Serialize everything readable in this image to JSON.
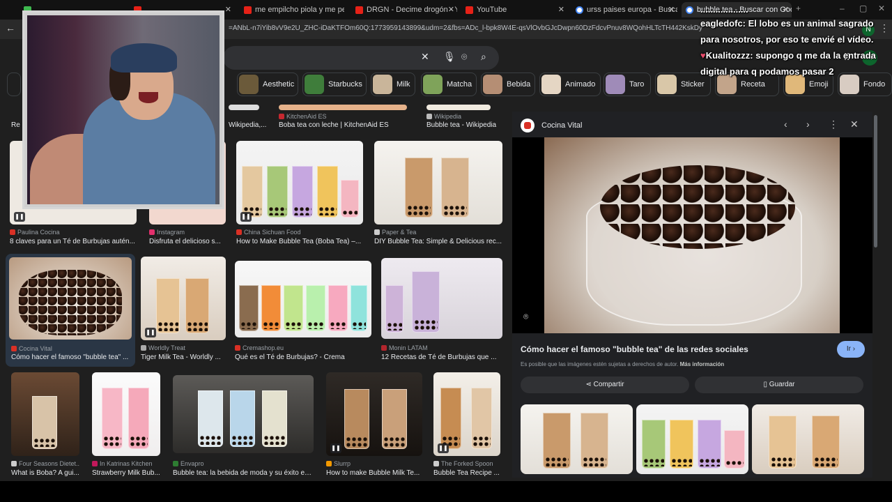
{
  "tabs": [
    {
      "title": "",
      "icon": "green-tab-icon"
    },
    {
      "title": "",
      "icon": "youtube-icon"
    },
    {
      "title": "me empilcho piola y me perfu",
      "icon": "youtube-icon"
    },
    {
      "title": "DRGN - Decime drogón - YouT",
      "icon": "youtube-icon"
    },
    {
      "title": "YouTube",
      "icon": "youtube-icon"
    },
    {
      "title": "urss paises europa - Buscar con",
      "icon": "google-icon"
    },
    {
      "title": "bubble tea - Buscar con Google",
      "icon": "google-icon",
      "active": true
    }
  ],
  "url": "=ANbL-n7iYib8vV9e2U_ZHC-iDaKTFOm60Q:1773959143899&udm=2&fbs=ADc_l-bpk8W4E-qsVlOvbGJcDwpn60DzFdcvPnuv8WQohHLTcTH442KskDyC74HpRHr",
  "profile_initial": "N",
  "chips": [
    {
      "label": "Aesthetic",
      "color": "#6b5a3a"
    },
    {
      "label": "Starbucks",
      "color": "#3f7d3b"
    },
    {
      "label": "Milk",
      "color": "#c9b59a"
    },
    {
      "label": "Matcha",
      "color": "#7fa35a"
    },
    {
      "label": "Bebida",
      "color": "#b58e74"
    },
    {
      "label": "Animado",
      "color": "#e5d6c4"
    },
    {
      "label": "Taro",
      "color": "#9f8bb8"
    },
    {
      "label": "Sticker",
      "color": "#d9c7a8"
    },
    {
      "label": "Receta",
      "color": "#c2a48a"
    },
    {
      "label": "Emoji",
      "color": "#e0b87a"
    },
    {
      "label": "Fondo",
      "color": "#d8ccc2"
    }
  ],
  "top_row": [
    {
      "source": "",
      "title": "Re"
    },
    {
      "source": "",
      "title": "Wikipedia,..."
    },
    {
      "source": "KitchenAid ES",
      "title": "Boba tea con leche | KitchenAid ES"
    },
    {
      "source": "Wikipedia",
      "title": "Bubble tea - Wikipedia"
    }
  ],
  "row1": [
    {
      "source": "Paulina Cocina",
      "title": "8 claves para un Té de Burbujas autén..."
    },
    {
      "source": "Instagram",
      "title": "Disfruta el delicioso s..."
    },
    {
      "source": "China Sichuan Food",
      "title": "How to Make Bubble Tea (Boba Tea) –..."
    },
    {
      "source": "Paper & Tea",
      "title": "DIY Bubble Tea: Simple & Delicious rec..."
    }
  ],
  "row2": [
    {
      "source": "Cocina Vital",
      "title": "Cómo hacer el famoso \"bubble tea\" ..."
    },
    {
      "source": "Worldly Treat",
      "title": "Tiger Milk Tea - Worldly ..."
    },
    {
      "source": "Cremashop.eu",
      "title": "Qué es el Té de Burbujas? - Crema"
    },
    {
      "source": "Monin LATAM",
      "title": "12 Recetas de Té de Burbujas que ..."
    }
  ],
  "row3": [
    {
      "source": "Four Seasons Dietet...",
      "title": "What is Boba? A gui..."
    },
    {
      "source": "In Katrinas Kitchen",
      "title": "Strawberry Milk Bub..."
    },
    {
      "source": "Envapro",
      "title": "Bubble tea: la bebida de moda y su éxito en ..."
    },
    {
      "source": "Slurrp",
      "title": "How to make Bubble Milk Te..."
    },
    {
      "source": "The Forked Spoon",
      "title": "Bubble Tea Recipe ..."
    }
  ],
  "panel": {
    "site": "Cocina Vital",
    "title": "Cómo hacer el famoso \"bubble tea\" de las redes sociales",
    "visit_label": "Ir",
    "disclaimer": "Es posible que las imágenes estén sujetas a derechos de autor.",
    "more_info": "Más información",
    "share_label": "Compartir",
    "save_label": "Guardar"
  },
  "chat": [
    {
      "user": "",
      "text": "...................",
      "prefix": ""
    },
    {
      "user": "eagledofc:",
      "text": "El lobo es un animal sagrado para nosotros, por eso te envié el vídeo.",
      "prefix": ""
    },
    {
      "user": "Kualitozzz:",
      "text": "supongo q me da la entrada digital para q podamos pasar 2",
      "prefix": "♥"
    }
  ],
  "colors": {
    "page_bg": "#1f1f1f",
    "panel_bg": "#202124",
    "accent_button": "#8ab4f8",
    "selected_card": "#2a3645"
  }
}
